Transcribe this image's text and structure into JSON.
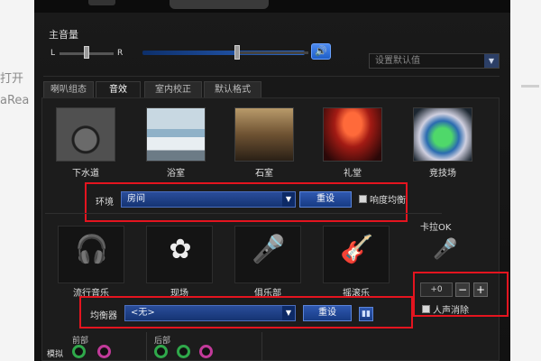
{
  "background_page": {
    "left_text_1": "打开",
    "left_text_2": "aRea"
  },
  "volume": {
    "title": "主音量",
    "left": "L",
    "right": "R",
    "speaker_icon": "speaker-icon",
    "default_dropdown": "设置默认值"
  },
  "tabs": [
    {
      "label": "喇叭组态"
    },
    {
      "label": "音效"
    },
    {
      "label": "室内校正"
    },
    {
      "label": "默认格式"
    }
  ],
  "environments": [
    {
      "label": "下水道",
      "icon": "sewer-scene"
    },
    {
      "label": "浴室",
      "icon": "bathtub-scene"
    },
    {
      "label": "石室",
      "icon": "stone-room-scene"
    },
    {
      "label": "礼堂",
      "icon": "auditorium-scene"
    },
    {
      "label": "竞技场",
      "icon": "arena-scene"
    }
  ],
  "env_row": {
    "label": "环境",
    "value": "房间",
    "reset": "重设",
    "loudness": "响度均衡"
  },
  "genres": [
    {
      "label": "流行音乐",
      "icon": "headphones-icon"
    },
    {
      "label": "现场",
      "icon": "disco-ball-icon"
    },
    {
      "label": "俱乐部",
      "icon": "microphone-icon"
    },
    {
      "label": "摇滚乐",
      "icon": "guitar-icon"
    }
  ],
  "eq_row": {
    "label": "均衡器",
    "value": "<无>",
    "reset": "重设",
    "eq_icon": "equalizer-icon"
  },
  "karaoke": {
    "title": "卡拉OK",
    "value": "+0",
    "minus": "−",
    "plus": "+",
    "voice_cancel": "人声消除"
  },
  "bottom": {
    "front": "前部",
    "rear": "后部",
    "analog": "模拟"
  },
  "colors": {
    "accent_blue": "#1e5ec7",
    "highlight_red": "#e4141f",
    "jack_green": "#2fa84a",
    "jack_pink": "#c23a9a"
  }
}
